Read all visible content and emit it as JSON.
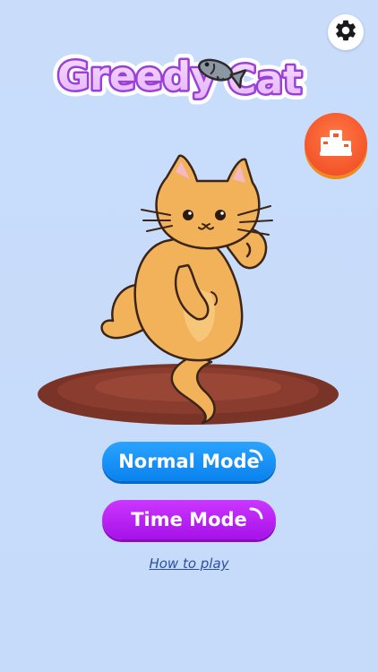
{
  "title": {
    "word1": "Greedy",
    "word2": "Cat"
  },
  "icons": {
    "settings": "gear-icon",
    "leaderboard": "podium-icon",
    "logo_fish": "fish-icon"
  },
  "buttons": {
    "normal_mode": "Normal Mode",
    "time_mode": "Time Mode"
  },
  "links": {
    "how_to_play": "How to play"
  },
  "colors": {
    "background": "#c8dcfa",
    "normal_mode": "#1591f5",
    "time_mode": "#b620f5",
    "leaderboard": "#f4552b",
    "logo_purple": "#9b3fd6",
    "cat_body": "#f2b25a",
    "rug": "#7a3427"
  }
}
